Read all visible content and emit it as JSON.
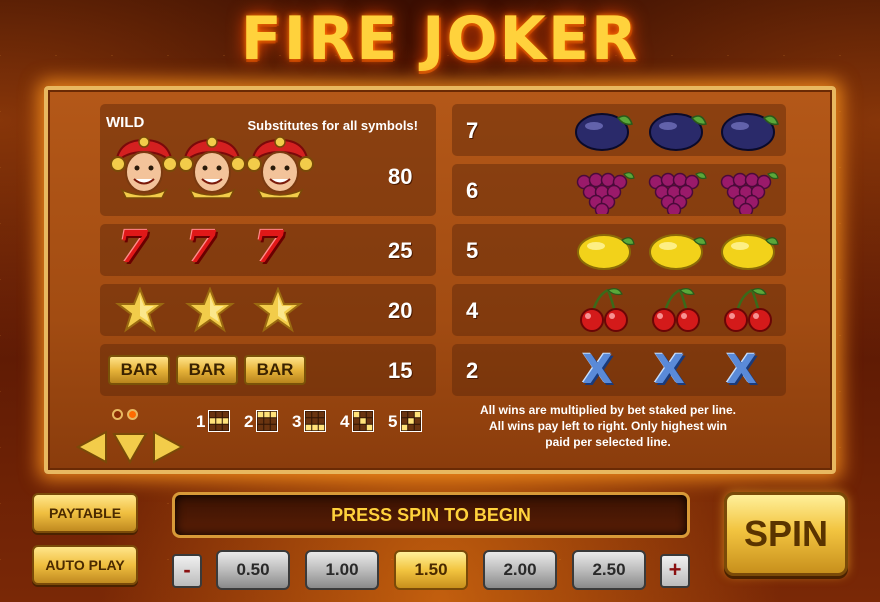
{
  "game": {
    "title": "FIRE JOKER"
  },
  "paytable": {
    "wild": {
      "label": "WILD",
      "description": "Substitutes for all symbols!",
      "payout": "80",
      "symbol_icon": "joker-icon"
    },
    "left_rows": [
      {
        "symbol": "seven",
        "icon": "seven-icon",
        "glyph": "7",
        "payout": "25"
      },
      {
        "symbol": "star",
        "icon": "star-icon",
        "payout": "20"
      },
      {
        "symbol": "bar",
        "icon": "bar-icon",
        "glyph": "BAR",
        "payout": "15"
      }
    ],
    "right_rows": [
      {
        "symbol": "plum",
        "icon": "plum-icon",
        "payout": "7"
      },
      {
        "symbol": "grapes",
        "icon": "grapes-icon",
        "payout": "6"
      },
      {
        "symbol": "lemon",
        "icon": "lemon-icon",
        "payout": "5"
      },
      {
        "symbol": "cherry",
        "icon": "cherry-icon",
        "payout": "4"
      },
      {
        "symbol": "x",
        "icon": "x-icon",
        "glyph": "X",
        "payout": "2"
      }
    ],
    "paylines": [
      "1",
      "2",
      "3",
      "4",
      "5"
    ],
    "info_lines": [
      "All wins are multiplied by bet staked per line.",
      "All wins pay left to right. Only highest win",
      "paid per selected line."
    ],
    "pages": {
      "total": 2,
      "current": 2
    }
  },
  "controls": {
    "paytable_label": "PAYTABLE",
    "autoplay_label": "AUTO PLAY",
    "message": "PRESS SPIN TO BEGIN",
    "spin_label": "SPIN",
    "minus_label": "-",
    "plus_label": "+",
    "stakes": [
      "0.50",
      "1.00",
      "1.50",
      "2.00",
      "2.50"
    ],
    "selected_stake": "1.50"
  },
  "colors": {
    "title": "#ffd23c",
    "panel_border": "#e8b860",
    "gold_button": "#f0bf40",
    "seven_red": "#e01818",
    "x_blue": "#5a8ad8"
  }
}
